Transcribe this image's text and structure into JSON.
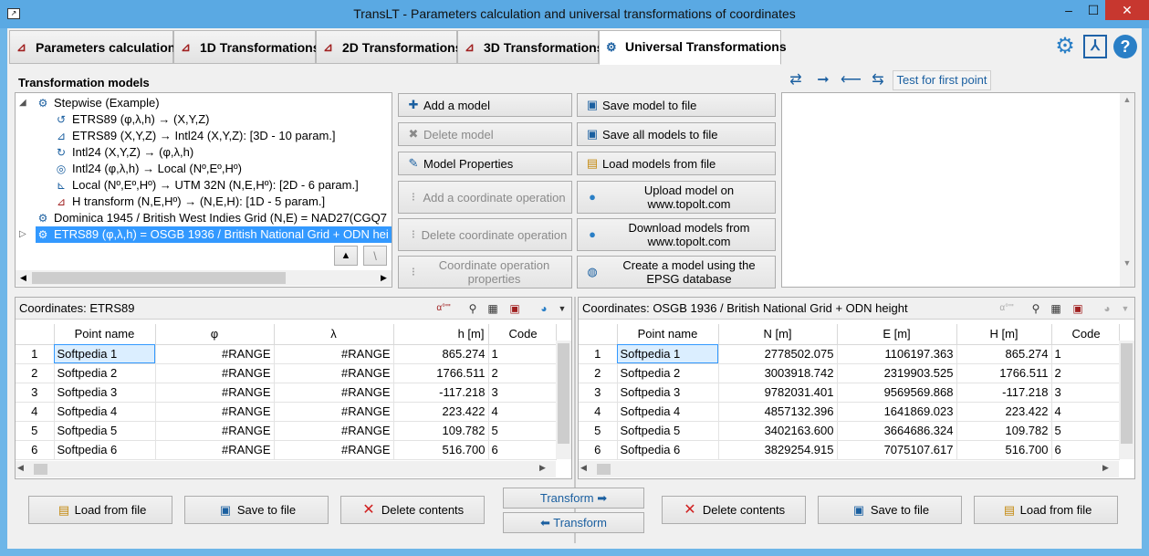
{
  "window": {
    "title": "TransLT - Parameters calculation and universal transformations of coordinates",
    "minimize": "–",
    "maximize": "☐",
    "close": "✕"
  },
  "tabs": [
    {
      "label": "Parameters calculation",
      "icon": "parameters-icon"
    },
    {
      "label": "1D Transformations",
      "icon": "transform-1d-icon"
    },
    {
      "label": "2D Transformations",
      "icon": "transform-2d-icon"
    },
    {
      "label": "3D Transformations",
      "icon": "transform-3d-icon"
    },
    {
      "label": "Universal Transformations",
      "icon": "universal-icon"
    }
  ],
  "top_icons": [
    "gear-icon",
    "pdf-icon",
    "help-icon"
  ],
  "models": {
    "heading": "Transformation models",
    "tree": [
      "Stepwise (Example)",
      "ETRS89 (φ,λ,h) → (X,Y,Z)",
      "ETRS89 (X,Y,Z) → Intl24 (X,Y,Z): [3D - 10 param.]",
      "Intl24 (X,Y,Z) → (φ,λ,h)",
      "Intl24 (φ,λ,h) → Local (Nº,Eº,Hº)",
      "Local (Nº,Eº,Hº) → UTM 32N (N,E,Hº): [2D - 6 param.]",
      "H transform (N,E,Hº) → (N,E,H): [1D - 5 param.]",
      "Dominica 1945 / British West Indies Grid (N,E) = NAD27(CGQ7",
      "ETRS89 (φ,λ,h) = OSGB 1936 / British National Grid + ODN hei"
    ],
    "up_button": "▲",
    "down_button": "\\",
    "buttons_mid": {
      "add": "Add a model",
      "delete": "Delete model",
      "props": "Model Properties",
      "add_op": "Add a coordinate operation",
      "del_op": "Delete coordinate operation",
      "op_props": "Coordinate operation properties"
    },
    "buttons_right": {
      "save": "Save model to file",
      "save_all": "Save all models to file",
      "load": "Load models from file",
      "upload": "Upload model on www.topolt.com",
      "download": "Download models from www.topolt.com",
      "epsg": "Create a model using the EPSG database"
    }
  },
  "test": {
    "label": "Test for first point"
  },
  "left_grid": {
    "title": "Coordinates: ETRS89",
    "columns": [
      "",
      "Point name",
      "φ",
      "λ",
      "h [m]",
      "Code"
    ],
    "rows": [
      [
        "1",
        "Softpedia 1",
        "#RANGE",
        "#RANGE",
        "865.274",
        "1"
      ],
      [
        "2",
        "Softpedia 2",
        "#RANGE",
        "#RANGE",
        "1766.511",
        "2"
      ],
      [
        "3",
        "Softpedia 3",
        "#RANGE",
        "#RANGE",
        "-117.218",
        "3"
      ],
      [
        "4",
        "Softpedia 4",
        "#RANGE",
        "#RANGE",
        "223.422",
        "4"
      ],
      [
        "5",
        "Softpedia 5",
        "#RANGE",
        "#RANGE",
        "109.782",
        "5"
      ],
      [
        "6",
        "Softpedia 6",
        "#RANGE",
        "#RANGE",
        "516.700",
        "6"
      ]
    ],
    "format_icon": "α°'\""
  },
  "right_grid": {
    "title": "Coordinates: OSGB 1936 / British National Grid + ODN height",
    "columns": [
      "",
      "Point name",
      "N [m]",
      "E [m]",
      "H [m]",
      "Code"
    ],
    "rows": [
      [
        "1",
        "Softpedia 1",
        "2778502.075",
        "1106197.363",
        "865.274",
        "1"
      ],
      [
        "2",
        "Softpedia 2",
        "3003918.742",
        "2319903.525",
        "1766.511",
        "2"
      ],
      [
        "3",
        "Softpedia 3",
        "9782031.401",
        "9569569.868",
        "-117.218",
        "3"
      ],
      [
        "4",
        "Softpedia 4",
        "4857132.396",
        "1641869.023",
        "223.422",
        "4"
      ],
      [
        "5",
        "Softpedia 5",
        "3402163.600",
        "3664686.324",
        "109.782",
        "5"
      ],
      [
        "6",
        "Softpedia 6",
        "3829254.915",
        "7075107.617",
        "516.700",
        "6"
      ]
    ],
    "format_icon": "α°'\""
  },
  "bottom": {
    "load_left": "Load from file",
    "save_left": "Save to file",
    "delete_left": "Delete contents",
    "transform_fwd": "Transform ➡",
    "transform_back": "⬅ Transform",
    "delete_right": "Delete contents",
    "save_right": "Save to file",
    "load_right": "Load from file"
  }
}
